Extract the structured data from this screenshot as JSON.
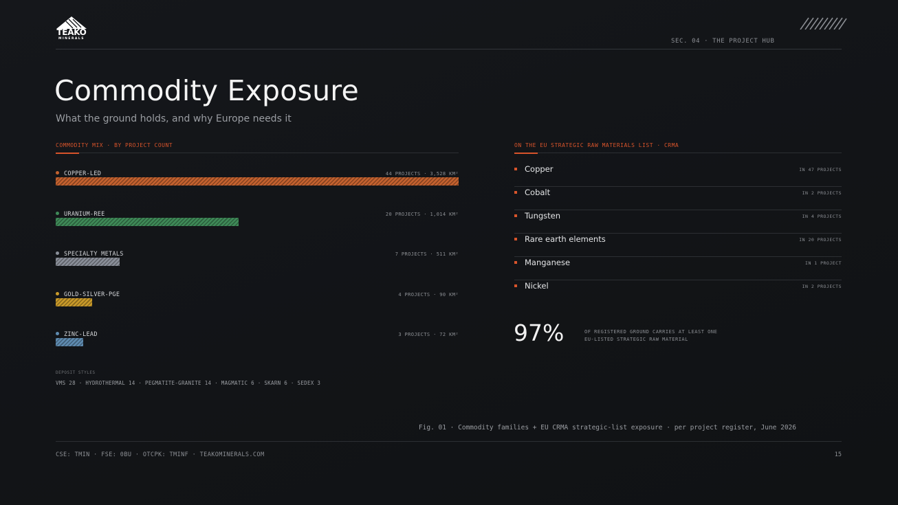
{
  "brand": {
    "name": "TEAKO",
    "sub": "MINERALS"
  },
  "section_label": "SEC. 04 · THE PROJECT HUB",
  "title": "Commodity Exposure",
  "subtitle": "What the ground holds, and why Europe needs it",
  "left_panel": {
    "heading": "COMMODITY MIX · BY PROJECT COUNT",
    "rows": [
      {
        "name": "COPPER-LED",
        "stat": "44 PROJECTS · 3,528 KM²",
        "projects": 44,
        "color": "#c4622f"
      },
      {
        "name": "URANIUM-REE",
        "stat": "20 PROJECTS · 1,014 KM²",
        "projects": 20,
        "color": "#3f8a58"
      },
      {
        "name": "SPECIALTY METALS",
        "stat": "7 PROJECTS · 511 KM²",
        "projects": 7,
        "color": "#8a8f99"
      },
      {
        "name": "GOLD-SILVER-PGE",
        "stat": "4 PROJECTS · 90 KM²",
        "projects": 4,
        "color": "#c99a2a"
      },
      {
        "name": "ZINC-LEAD",
        "stat": "3 PROJECTS · 72 KM²",
        "projects": 3,
        "color": "#5f8bb0"
      }
    ],
    "deposit_label": "DEPOSIT STYLES",
    "deposit_list": "VMS 28 · HYDROTHERMAL 14 · PEGMATITE-GRANITE 14 · MAGMATIC 6 · SKARN 6 · SEDEX 3"
  },
  "right_panel": {
    "heading": "ON THE EU STRATEGIC RAW MATERIALS LIST · CRMA",
    "materials": [
      {
        "name": "Copper",
        "count": "IN 47 PROJECTS"
      },
      {
        "name": "Cobalt",
        "count": "IN 2 PROJECTS"
      },
      {
        "name": "Tungsten",
        "count": "IN 4 PROJECTS"
      },
      {
        "name": "Rare earth elements",
        "count": "IN 20 PROJECTS"
      },
      {
        "name": "Manganese",
        "count": "IN 1 PROJECT"
      },
      {
        "name": "Nickel",
        "count": "IN 2 PROJECTS"
      }
    ],
    "big_pct": "97%",
    "pct_note": "OF REGISTERED GROUND CARRIES AT LEAST ONE EU-LISTED STRATEGIC RAW MATERIAL"
  },
  "fig_caption": "Fig. 01 · Commodity families + EU CRMA strategic-list exposure · per project register, June 2026",
  "footer": "CSE: TMIN · FSE: 0BU · OTCPK: TMINF · TEAKOMINERALS.COM",
  "page_number": "15",
  "colors": {
    "accent": "#d8542b",
    "background": "#131518"
  }
}
